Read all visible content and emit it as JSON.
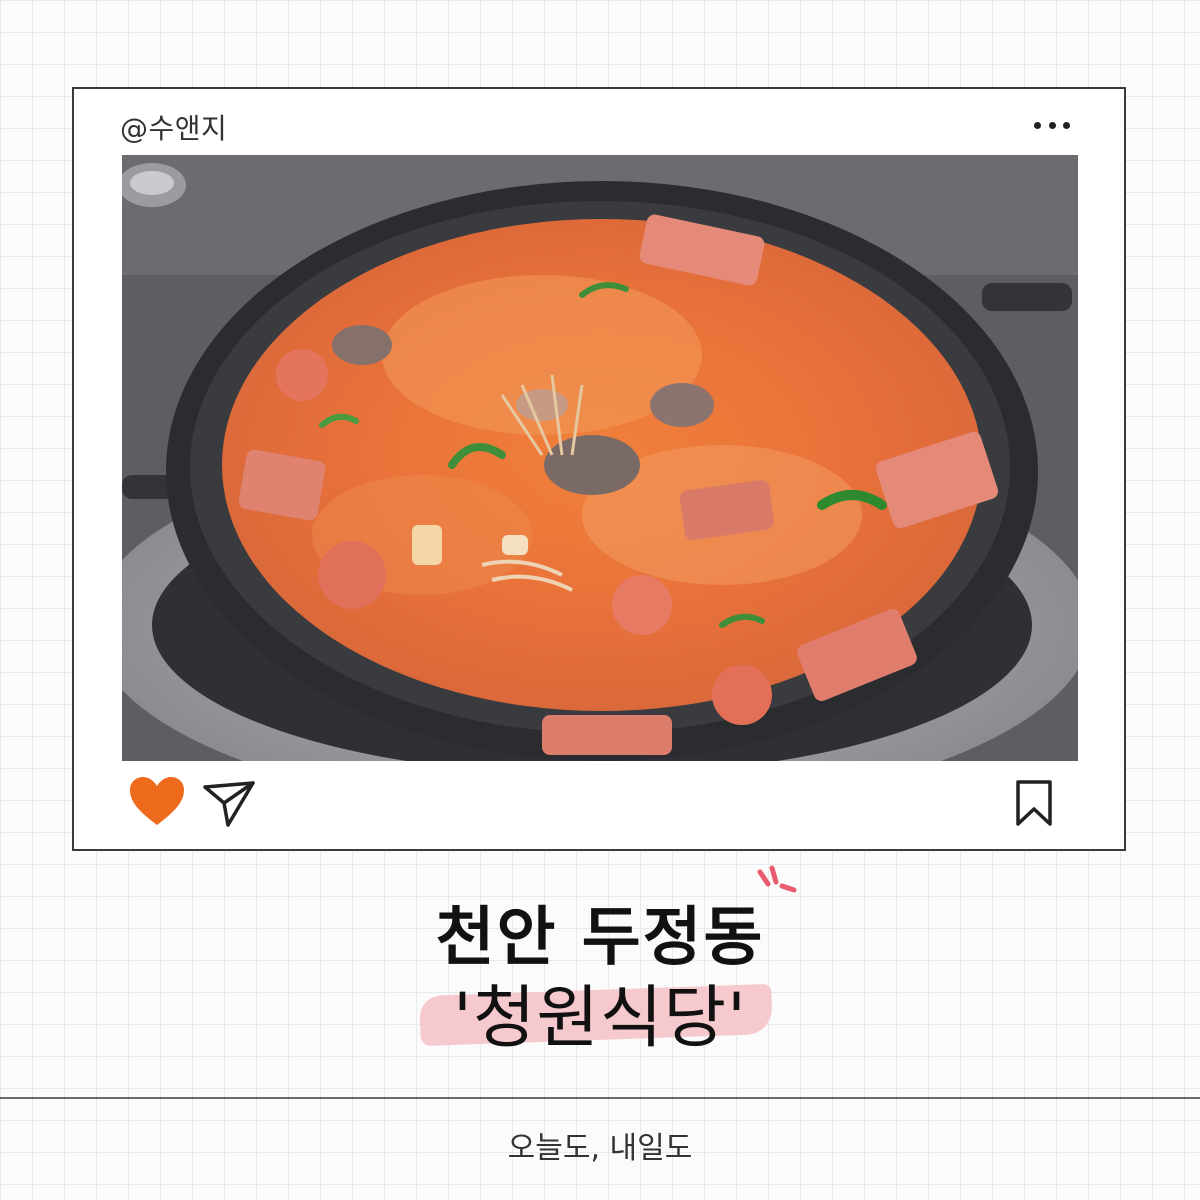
{
  "post": {
    "handle": "@수앤지",
    "photo_subject": "spicy-stew-hotpot",
    "icons": {
      "more": "more-dots-icon",
      "like": "heart-icon",
      "share": "send-icon",
      "save": "bookmark-icon"
    },
    "like_color": "#ee6a1c"
  },
  "title": {
    "line1": "천안 두정동",
    "line2": "'청원식당'",
    "highlight_color": "#f5c9cd",
    "sparkle_color": "#e85a6e"
  },
  "footer": {
    "tagline": "오늘도, 내일도"
  }
}
